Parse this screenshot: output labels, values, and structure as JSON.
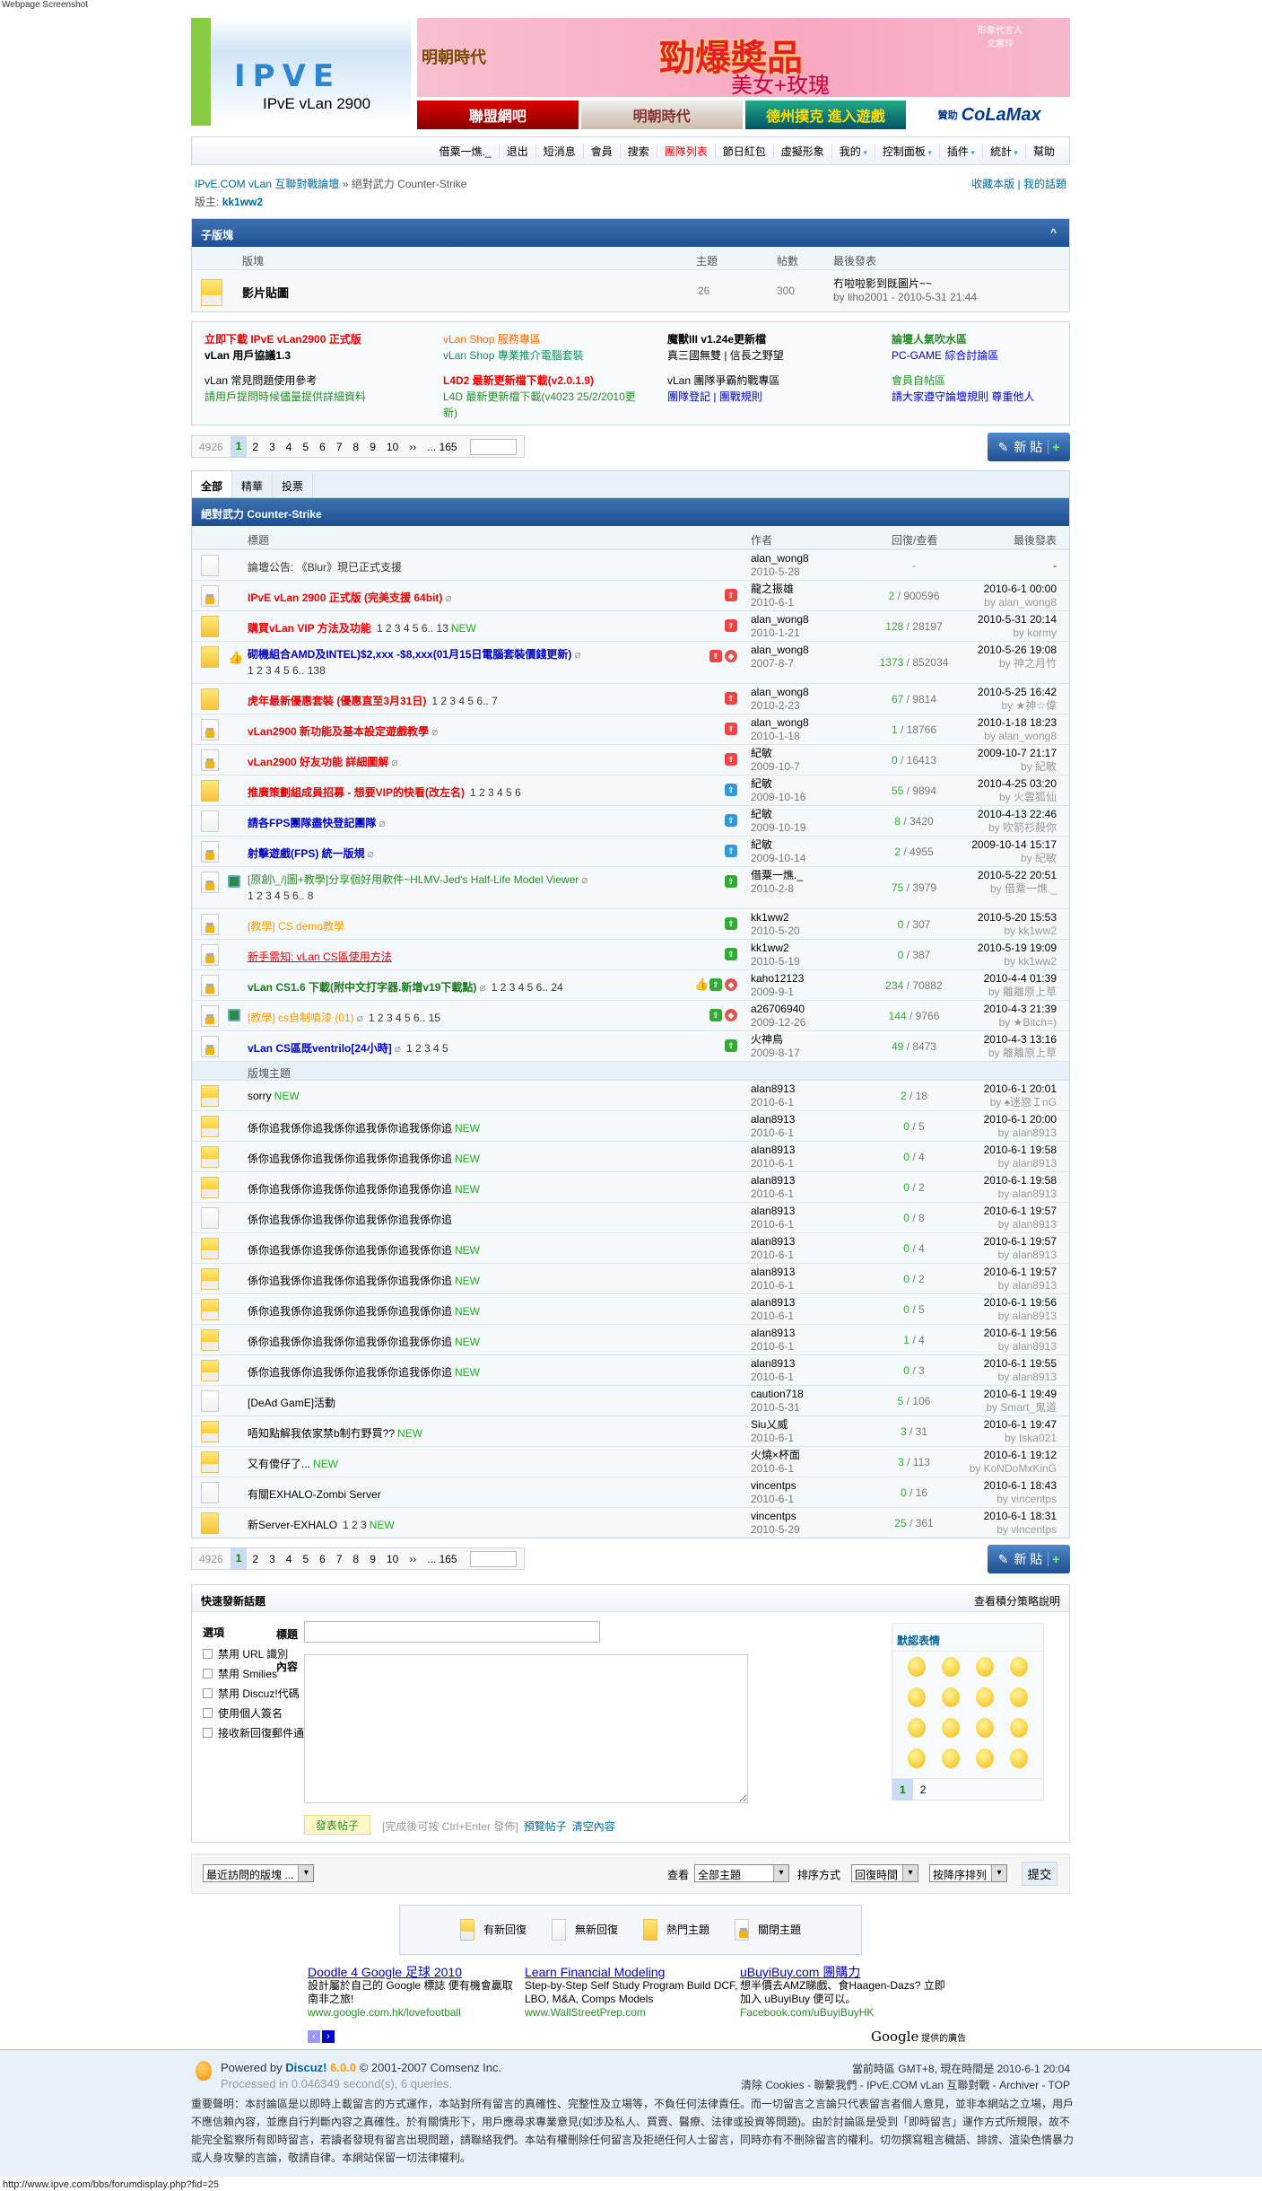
{
  "screenshot_label": "Webpage Screenshot",
  "header": {
    "logo_text": "IPVE",
    "logo_subtitle": "IPvE vLan 2900",
    "banner": {
      "brand": "明朝時代",
      "headline": "勁爆奬品",
      "subline": "美女+玫瑰",
      "spokesperson": "形象代言人 文紫玲"
    },
    "sub_banners": [
      "聯盟網吧",
      "明朝時代",
      "德州撲克 進入遊戲"
    ],
    "sponsor": {
      "label": "贊助",
      "brand": "CoLaMax",
      "url": "www.colamax.com"
    }
  },
  "nav": {
    "items": [
      {
        "label": "借粟一燋._"
      },
      {
        "label": "退出"
      },
      {
        "label": "短消息"
      },
      {
        "label": "會員"
      },
      {
        "label": "搜索"
      },
      {
        "label": "團隊列表",
        "highlight": true
      },
      {
        "label": "節日紅包"
      },
      {
        "label": "虛擬形象"
      },
      {
        "label": "我的",
        "dropdown": true
      },
      {
        "label": "控制面板",
        "dropdown": true
      },
      {
        "label": "插件",
        "dropdown": true
      },
      {
        "label": "統計",
        "dropdown": true
      },
      {
        "label": "幫助"
      }
    ]
  },
  "breadcrumb": {
    "home": "IPvE.COM vLan 互聯對戰論壇",
    "sep": "»",
    "current": "絕對武力 Counter-Strike",
    "moderator_label": "版主:",
    "moderator": "kk1ww2",
    "favorite": "收藏本版",
    "my_topics": "我的話題",
    "divider": "|"
  },
  "subforums": {
    "title": "子版塊",
    "collapse": "^",
    "headers": {
      "forum": "版塊",
      "topics": "主題",
      "posts": "帖數",
      "last": "最後發表"
    },
    "items": [
      {
        "name": "影片貼圖",
        "topics": "26",
        "posts": "300",
        "last_title": "冇啦啦影到既圖片~~",
        "last_by": "by liho2001 - 2010-5-31 21:44"
      }
    ]
  },
  "links": [
    [
      {
        "text": "立即下載 IPvE vLan2900 正式版",
        "color": "#e00",
        "bold": true
      },
      {
        "text": "vLan 用戶協議1.3",
        "color": "#000",
        "bold": true
      },
      {
        "text": "vLan 常見問題使用參考",
        "color": "#000"
      },
      {
        "text": "請用戶提問時候儘量提供詳細資料",
        "color": "#2a8a2a"
      }
    ],
    [
      {
        "text": "vLan Shop 服務專區",
        "color": "#f60"
      },
      {
        "text": "vLan Shop 專業推介電腦套裝",
        "color": "#1a8a5a"
      },
      {
        "text": "L4D2 最新更新檔下載(v2.0.1.9)",
        "color": "#e00",
        "bold": true
      },
      {
        "text": "L4D 最新更新檔下載(v4023 25/2/2010更新)",
        "color": "#2a8a2a"
      }
    ],
    [
      {
        "text": "魔獸III v1.24e更新檔",
        "color": "#000",
        "bold": true
      },
      {
        "text": "真三國無雙 | 信長之野望",
        "color": "#000"
      },
      {
        "text": "vLan 團隊爭霸約戰專區",
        "color": "#000"
      },
      {
        "text": "團隊登記 | 團戰規則",
        "color": "#00c"
      }
    ],
    [
      {
        "text": "論壇人氣吹水區",
        "color": "#2a8a2a",
        "bold": true
      },
      {
        "text": "PC-GAME 綜合討論區",
        "color": "#00c"
      },
      {
        "text": "會員自帖區",
        "color": "#2a8a2a"
      },
      {
        "text": "請大家遵守論壇規則 尊重他人",
        "color": "#00c"
      }
    ]
  ],
  "pager": {
    "total": "4926",
    "current": "1",
    "pages": [
      "2",
      "3",
      "4",
      "5",
      "6",
      "7",
      "8",
      "9",
      "10"
    ],
    "next": "››",
    "last": "... 165",
    "new_post": "新 貼",
    "plus": "+"
  },
  "tabs": [
    {
      "label": "全部",
      "active": true
    },
    {
      "label": "精華"
    },
    {
      "label": "投票"
    }
  ],
  "forum": {
    "title": "絕對武力 Counter-Strike",
    "headers": {
      "title": "標題",
      "author": "作者",
      "stats": "回復/查看",
      "last": "最後發表"
    },
    "section_label": "版塊主題"
  },
  "threads": [
    {
      "icon": "nonew",
      "title": "論壇公告: 《Blur》現已正式支援",
      "color": "#333",
      "author": "alan_wong8",
      "date": "2010-5-28",
      "replies": "-",
      "views": "",
      "last_time": "-",
      "last_by": ""
    },
    {
      "icon": "lock",
      "title": "IPvE vLan 2900 正式版 (完美支援 64bit)",
      "color": "#e00",
      "bold": true,
      "attach": true,
      "badges": [
        "up3"
      ],
      "author": "龍之振雄",
      "date": "2010-6-1",
      "replies": "2",
      "views": "900596",
      "last_time": "2010-6-1 00:00",
      "last_by": "by alan_wong8"
    },
    {
      "icon": "hot",
      "title": "購買vLan VIP 方法及功能",
      "color": "#e00",
      "bold": true,
      "pages": "1 2 3 4 5 6.. 13",
      "isnew": true,
      "badges": [
        "up3"
      ],
      "author": "alan_wong8",
      "date": "2010-1-21",
      "replies": "128",
      "views": "28197",
      "last_time": "2010-5-31 20:14",
      "last_by": "by kormy"
    },
    {
      "icon": "hot",
      "icon2": "thumb",
      "title": "砌機組合AMD及INTEL)$2,xxx -$8,xxx(01月15日電腦套裝價錢更新)",
      "color": "#00c",
      "bold": true,
      "attach": true,
      "pages": "1 2 3 4 5 6.. 138",
      "two": true,
      "badges": [
        "up3",
        "digest"
      ],
      "author": "alan_wong8",
      "date": "2007-8-7",
      "replies": "1373",
      "views": "852034",
      "last_time": "2010-5-26 19:08",
      "last_by": "by 神之月竹"
    },
    {
      "icon": "hot",
      "title": "虎年最新優惠套裝 (優惠直至3月31日)",
      "color": "#e00",
      "bold": true,
      "pages": "1 2 3 4 5 6.. 7",
      "badges": [
        "up3"
      ],
      "author": "alan_wong8",
      "date": "2010-2-23",
      "replies": "67",
      "views": "9814",
      "last_time": "2010-5-25 16:42",
      "last_by": "by ★神☆偉"
    },
    {
      "icon": "lock",
      "title": "vLan2900 新功能及基本設定遊戲教學",
      "color": "#e00",
      "bold": true,
      "attach": true,
      "badges": [
        "up3"
      ],
      "author": "alan_wong8",
      "date": "2010-1-18",
      "replies": "1",
      "views": "18766",
      "last_time": "2010-1-18 18:23",
      "last_by": "by alan_wong8"
    },
    {
      "icon": "lock",
      "title": "vLan2900 好友功能 詳細圖解",
      "color": "#e00",
      "bold": true,
      "attach": true,
      "badges": [
        "up3"
      ],
      "author": "紀敏",
      "date": "2009-10-7",
      "replies": "0",
      "views": "16413",
      "last_time": "2009-10-7 21:17",
      "last_by": "by 紀敏"
    },
    {
      "icon": "hot",
      "title": "推廣策劃組成員招募 - 想要VIP的快看(改左名)",
      "color": "#e00",
      "bold": true,
      "pages": "1 2 3 4 5 6",
      "badges": [
        "up2"
      ],
      "author": "紀敏",
      "date": "2009-10-16",
      "replies": "55",
      "views": "9894",
      "last_time": "2010-4-25 03:20",
      "last_by": "by 火雲狐仙"
    },
    {
      "icon": "nonew",
      "title": "請各FPS團隊盡快登記團隊",
      "color": "#00c",
      "bold": true,
      "attach": true,
      "badges": [
        "up2"
      ],
      "author": "紀敏",
      "date": "2009-10-19",
      "replies": "8",
      "views": "3420",
      "last_time": "2010-4-13 22:46",
      "last_by": "by 吹箭衫殺你"
    },
    {
      "icon": "lock",
      "title": "射擊遊戲(FPS) 統一版規",
      "color": "#00c",
      "bold": true,
      "attach": true,
      "badges": [
        "up2"
      ],
      "author": "紀敏",
      "date": "2009-10-14",
      "replies": "2",
      "views": "4955",
      "last_time": "2009-10-14 15:17",
      "last_by": "by 紀敏"
    },
    {
      "icon": "lock",
      "icon2": "image",
      "title": "[原創\\_/|圖+教學]分享個好用軟件~HLMV-Jed's Half-Life Model Viewer",
      "color": "#2a8a2a",
      "attach": true,
      "pages": "1 2 3 4 5 6.. 8",
      "two": true,
      "badges": [
        "up1"
      ],
      "author": "借粟一燋._",
      "date": "2010-2-8",
      "replies": "75",
      "views": "3979",
      "last_time": "2010-5-22 20:51",
      "last_by": "by 借粟一燋._"
    },
    {
      "icon": "lock",
      "title": "[教學] CS demo教學",
      "color": "#f90",
      "badges": [
        "up1"
      ],
      "author": "kk1ww2",
      "date": "2010-5-20",
      "replies": "0",
      "views": "307",
      "last_time": "2010-5-20 15:53",
      "last_by": "by kk1ww2"
    },
    {
      "icon": "lock",
      "title": "新手需知: vLan CS區使用方法",
      "color": "#e00",
      "underline": true,
      "badges": [
        "up1"
      ],
      "author": "kk1ww2",
      "date": "2010-5-19",
      "replies": "0",
      "views": "387",
      "last_time": "2010-5-19 19:09",
      "last_by": "by kk1ww2"
    },
    {
      "icon": "lock",
      "title": "vLan CS1.6 下載(附中文打字器.新增v19下載點)",
      "color": "#1a7a1a",
      "bold": true,
      "attach": true,
      "pages": "1 2 3 4 5 6.. 24",
      "badges": [
        "thumb",
        "up1",
        "digest"
      ],
      "author": "kaho12123",
      "date": "2009-9-1",
      "replies": "234",
      "views": "70882",
      "last_time": "2010-4-4 01:39",
      "last_by": "by 離離原上草"
    },
    {
      "icon": "lock",
      "icon2": "image",
      "title": "[教學] cs自制噴漆 (01)",
      "color": "#f90",
      "attach": true,
      "pages": "1 2 3 4 5 6.. 15",
      "badges": [
        "up1",
        "digest"
      ],
      "author": "a26706940",
      "date": "2009-12-26",
      "replies": "144",
      "views": "9766",
      "last_time": "2010-4-3 21:39",
      "last_by": "by ★Bitch=)"
    },
    {
      "icon": "lock",
      "title": "vLan CS區既ventrilo[24小時]",
      "color": "#00c",
      "bold": true,
      "attach": true,
      "pages": "1 2 3 4 5",
      "badges": [
        "up1"
      ],
      "author": "火神鳥",
      "date": "2009-8-17",
      "replies": "49",
      "views": "8473",
      "last_time": "2010-4-3 13:16",
      "last_by": "by 離離原上草"
    },
    {
      "section": true
    },
    {
      "icon": "new",
      "title": "sorry",
      "color": "#000",
      "isnew": true,
      "author": "alan8913",
      "date": "2010-6-1",
      "replies": "2",
      "views": "18",
      "last_time": "2010-6-1 20:01",
      "last_by": "by ♠迷戀ＩnG"
    },
    {
      "icon": "new",
      "title": "係你追我係你追我係你追我係你追我係你追",
      "color": "#000",
      "isnew": true,
      "author": "alan8913",
      "date": "2010-6-1",
      "replies": "0",
      "views": "5",
      "last_time": "2010-6-1 20:00",
      "last_by": "by alan8913"
    },
    {
      "icon": "new",
      "title": "係你追我係你追我係你追我係你追我係你追",
      "color": "#000",
      "isnew": true,
      "author": "alan8913",
      "date": "2010-6-1",
      "replies": "0",
      "views": "4",
      "last_time": "2010-6-1 19:58",
      "last_by": "by alan8913"
    },
    {
      "icon": "new",
      "title": "係你追我係你追我係你追我係你追我係你追",
      "color": "#000",
      "isnew": true,
      "author": "alan8913",
      "date": "2010-6-1",
      "replies": "0",
      "views": "2",
      "last_time": "2010-6-1 19:58",
      "last_by": "by alan8913"
    },
    {
      "icon": "nonew",
      "title": "係你追我係你追我係你追我係你追我係你追",
      "color": "#000",
      "author": "alan8913",
      "date": "2010-6-1",
      "replies": "0",
      "views": "8",
      "last_time": "2010-6-1 19:57",
      "last_by": "by alan8913"
    },
    {
      "icon": "new",
      "title": "係你追我係你追我係你追我係你追我係你追",
      "color": "#000",
      "isnew": true,
      "author": "alan8913",
      "date": "2010-6-1",
      "replies": "0",
      "views": "4",
      "last_time": "2010-6-1 19:57",
      "last_by": "by alan8913"
    },
    {
      "icon": "new",
      "title": "係你追我係你追我係你追我係你追我係你追",
      "color": "#000",
      "isnew": true,
      "author": "alan8913",
      "date": "2010-6-1",
      "replies": "0",
      "views": "2",
      "last_time": "2010-6-1 19:57",
      "last_by": "by alan8913"
    },
    {
      "icon": "new",
      "title": "係你追我係你追我係你追我係你追我係你追",
      "color": "#000",
      "isnew": true,
      "author": "alan8913",
      "date": "2010-6-1",
      "replies": "0",
      "views": "5",
      "last_time": "2010-6-1 19:56",
      "last_by": "by alan8913"
    },
    {
      "icon": "new",
      "title": "係你追我係你追我係你追我係你追我係你追",
      "color": "#000",
      "isnew": true,
      "author": "alan8913",
      "date": "2010-6-1",
      "replies": "1",
      "views": "4",
      "last_time": "2010-6-1 19:56",
      "last_by": "by alan8913"
    },
    {
      "icon": "new",
      "title": "係你追我係你追我係你追我係你追我係你追",
      "color": "#000",
      "isnew": true,
      "author": "alan8913",
      "date": "2010-6-1",
      "replies": "0",
      "views": "3",
      "last_time": "2010-6-1 19:55",
      "last_by": "by alan8913"
    },
    {
      "icon": "nonew",
      "title": "[DeAd GamE]活動",
      "color": "#000",
      "author": "caution718",
      "date": "2010-5-31",
      "replies": "5",
      "views": "106",
      "last_time": "2010-6-1 19:49",
      "last_by": "by Smart_鬼道"
    },
    {
      "icon": "new",
      "title": "唔知點解我依家禁b制冇野買??",
      "color": "#000",
      "isnew": true,
      "author": "Siu乂威",
      "date": "2010-6-1",
      "replies": "3",
      "views": "31",
      "last_time": "2010-6-1 19:47",
      "last_by": "by Iska021"
    },
    {
      "icon": "new",
      "title": "又有傻仔了...",
      "color": "#000",
      "isnew": true,
      "author": "火燒×杯面",
      "date": "2010-6-1",
      "replies": "3",
      "views": "113",
      "last_time": "2010-6-1 19:12",
      "last_by": "by KoNDoMxKinG"
    },
    {
      "icon": "nonew",
      "title": "有關EXHALO-Zombi Server",
      "color": "#000",
      "author": "vincentps",
      "date": "2010-6-1",
      "replies": "0",
      "views": "16",
      "last_time": "2010-6-1 18:43",
      "last_by": "by vincentps"
    },
    {
      "icon": "hot",
      "title": "新Server-EXHALO",
      "color": "#000",
      "pages": "1 2 3",
      "isnew": true,
      "author": "vincentps",
      "date": "2010-5-29",
      "replies": "25",
      "views": "361",
      "last_time": "2010-6-1 18:31",
      "last_by": "by vincentps"
    }
  ],
  "new_label": "NEW",
  "quick_post": {
    "title": "快速發新話題",
    "credits_link": "查看積分策略說明",
    "options_label": "選項",
    "options": [
      "禁用 URL 識別",
      "禁用 Smilies",
      "禁用 Discuz!代碼",
      "使用個人簽名",
      "接收新回復郵件通知"
    ],
    "subject_label": "標題",
    "content_label": "內容",
    "subject_value": "",
    "content_value": "",
    "submit": "發表帖子",
    "hint": "[完成後可按 Ctrl+Enter 發佈]",
    "preview": "預覽帖子",
    "clear": "清空內容",
    "smilies_title": "默認表情",
    "smilies_pages": [
      "1",
      "2"
    ]
  },
  "jump": {
    "forum_select": "最近訪問的版塊 ...",
    "view_label": "查看",
    "view_value": "全部主題",
    "sort_label": "排序方式",
    "sort_value": "回復時間",
    "order_value": "按降序排列",
    "submit": "提交"
  },
  "legend": [
    {
      "icon": "new",
      "label": "有新回復"
    },
    {
      "icon": "nonew",
      "label": "無新回復"
    },
    {
      "icon": "hot",
      "label": "熱門主題"
    },
    {
      "icon": "lock",
      "label": "關閉主題"
    }
  ],
  "ads": [
    {
      "title": "Doodle 4 Google 足球 2010",
      "body": "設計屬於自己的 Google 標誌 便有機會贏取南非之旅!",
      "url": "www.google.com.hk/lovefootball"
    },
    {
      "title": "Learn Financial Modeling",
      "body": "Step-by-Step Self Study Program Build DCF, LBO, M&A, Comps Models",
      "url": "www.WallStreetPrep.com"
    },
    {
      "title": "uBuyiBuy.com 團購力",
      "body": "想半價去AMZ睇戲、食Haagen-Dazs? 立即加入 uBuyiBuy 便可以。",
      "url": "Facebook.com/uBuyiBuyHK"
    }
  ],
  "ads_nav": [
    "‹",
    "›"
  ],
  "ads_by": {
    "brand": "Google",
    "label": "提供的廣告"
  },
  "footer": {
    "powered": "Powered by",
    "discuz": "Discuz!",
    "version": "6.0.0",
    "copyright": "© 2001-2007 Comsenz Inc.",
    "processed": "Processed in 0.046349 second(s), 6 queries.",
    "timezone": "當前時區 GMT+8, 現在時間是 2010-6-1 20:04",
    "links": "清除 Cookies - 聯繫我們 - IPvE.COM vLan 互聯對戰 - Archiver - TOP",
    "disclaimer": "重要聲明：本討論區是以即時上載留言的方式運作，本站對所有留言的真確性、完整性及立場等，不負任何法律責任。而一切留言之言論只代表留言者個人意見，並非本網站之立場，用戶不應信賴內容，並應自行判斷內容之真確性。於有關情形下，用戶應尋求專業意見(如涉及私人、買賣、醫療、法律或投資等問題)。由於討論區是受到「即時留言」運作方式所規限，故不能完全監察所有即時留言，若讀者發現有留言出現問題，請聯絡我們。本站有權刪除任何留言及拒絕任何人士留言，同時亦有不刪除留言的權利。切勿撰寫粗言穢語、誹謗、渲染色情暴力或人身攻擊的言論，敬請自律。本網站保留一切法律權利。"
  },
  "status_url": "http://www.ipve.com/bbs/forumdisplay.php?fid=25"
}
